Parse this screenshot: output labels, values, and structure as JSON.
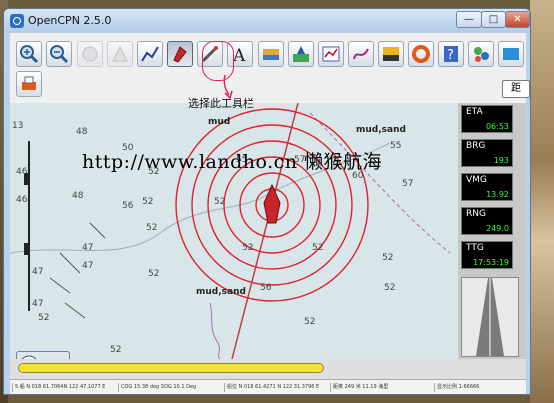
{
  "window": {
    "title": "OpenCPN 2.5.0",
    "min_glyph": "—",
    "max_glyph": "□",
    "close_glyph": "✕"
  },
  "toolbar": {
    "buttons": [
      {
        "name": "zoom-in-icon"
      },
      {
        "name": "zoom-out-icon"
      },
      {
        "name": "scale-in-icon"
      },
      {
        "name": "scale-out-icon"
      },
      {
        "name": "route-icon"
      },
      {
        "name": "ship-follow-icon"
      },
      {
        "name": "measure-tool-icon"
      },
      {
        "name": "text-icon"
      },
      {
        "name": "chart-quilt-icon"
      },
      {
        "name": "tide-icon"
      },
      {
        "name": "route-manager-icon"
      },
      {
        "name": "track-icon"
      },
      {
        "name": "colour-scheme-icon"
      },
      {
        "name": "man-overboard-icon"
      },
      {
        "name": "print-icon"
      },
      {
        "name": "help-icon"
      },
      {
        "name": "settings-icon"
      },
      {
        "name": "ais-icon"
      }
    ],
    "caption": "选择此工具栏",
    "side_tab": "距"
  },
  "chart": {
    "soundings": [
      "48",
      "52",
      "55",
      "57",
      "50",
      "56",
      "46",
      "46",
      "52",
      "52",
      "55",
      "57",
      "60",
      "52",
      "52",
      "56",
      "52",
      "47",
      "47",
      "47",
      "52",
      "52",
      "52",
      "52",
      "52",
      "52",
      "48",
      "47"
    ],
    "labels": [
      "mud",
      "mud,sand",
      "mud,sand"
    ],
    "scale_left": "13",
    "watermark": "http://www.landho.cn 懒猴航海"
  },
  "instruments": [
    {
      "label": "ETA",
      "value": "06:53"
    },
    {
      "label": "BRG",
      "value": "193"
    },
    {
      "label": "VMG",
      "value": "13.92"
    },
    {
      "label": "RNG",
      "value": "249.0"
    },
    {
      "label": "TTG",
      "value": "17:53:19"
    }
  ],
  "status_bar": {
    "fields": [
      "S 船 N 018 61.7064N 122 47.1077 E",
      "COG 15.38 deg SOG 10.1 Deg",
      "船位 N 018 61.4271 N 122 31.3796 E",
      "距离 249 米 11.19 海里",
      "显示比例 1:66666"
    ]
  },
  "colors": {
    "range_rings": "#e0202a",
    "instrument_value": "#33ff33",
    "progress": "#f2e430"
  },
  "progress": {
    "fraction": 1.0
  }
}
